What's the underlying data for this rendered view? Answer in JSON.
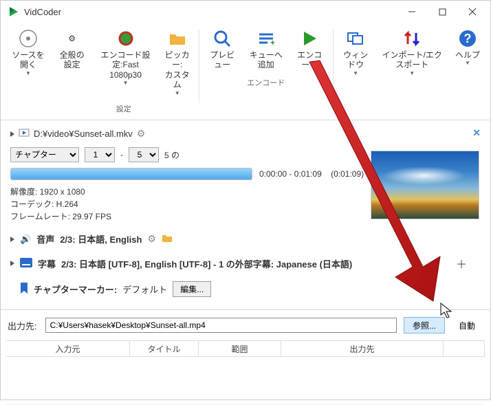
{
  "title": "VidCoder",
  "toolbar": {
    "open_source": "ソースを開く",
    "global_settings": "全般の設定",
    "encode_settings": "エンコード設定:Fast\n1080p30",
    "picker": "ピッカー:\nカスタム",
    "preview": "プレビュー",
    "queue_add": "キューへ追加",
    "encode": "エンコード",
    "window": "ウィンドウ",
    "import_export": "インポート/エクスポート",
    "help": "ヘルプ",
    "group_settings": "設定",
    "group_encode": "エンコード"
  },
  "source": {
    "path": "D:¥video¥Sunset-all.mkv",
    "chapter_label": "チャプター",
    "chapter_from": "1",
    "chapter_sep": "-",
    "chapter_to": "5",
    "chapter_suffix": "5 の",
    "time_range": "0:00:00 - 0:01:09",
    "time_total": "(0:01:09)",
    "resolution": "解像度: 1920 x 1080",
    "codec": "コーデック: H.264",
    "framerate": "フレームレート: 29.97 FPS",
    "audio_label": "音声",
    "audio_summary": "2/3: 日本語, English",
    "subs_label": "字幕",
    "subs_summary": "2/3: 日本語 [UTF-8], English [UTF-8] - 1 の外部字幕: Japanese (日本語)",
    "chapters_marker": "チャプターマーカー:",
    "chapters_marker_value": "デフォルト",
    "edit": "編集..."
  },
  "output": {
    "label": "出力先:",
    "path": "C:¥Users¥hasek¥Desktop¥Sunset-all.mp4",
    "browse": "参照...",
    "auto": "自動"
  },
  "grid": {
    "col_input": "入力元",
    "col_title": "タイトル",
    "col_range": "範囲",
    "col_output": "出力先"
  }
}
